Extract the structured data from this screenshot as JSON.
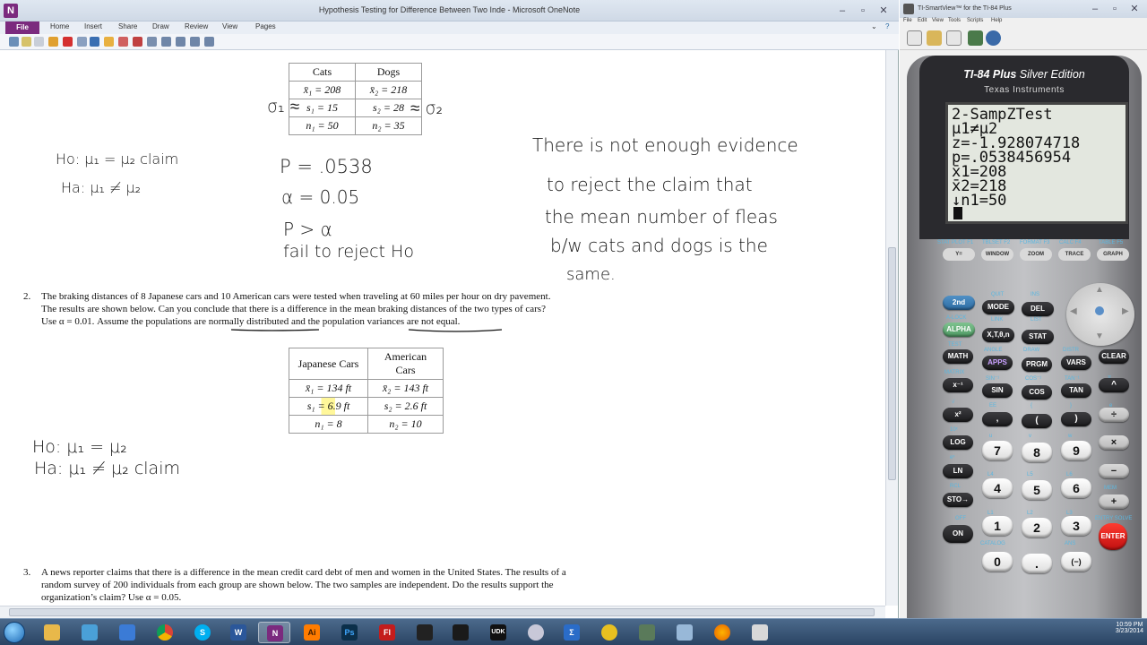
{
  "onenote": {
    "title": "Hypothesis Testing for Difference Between Two Inde  -  Microsoft OneNote",
    "app_letter": "N",
    "tabs": [
      "File",
      "Home",
      "Insert",
      "Share",
      "Draw",
      "Review",
      "View",
      "Pages"
    ],
    "table1": {
      "headers": [
        "Cats",
        "Dogs"
      ],
      "rows": [
        [
          "x̄₁ = 208",
          "x̄₂ = 218"
        ],
        [
          "s₁ = 15",
          "s₂ = 28"
        ],
        [
          "n₁ = 50",
          "n₂ = 35"
        ]
      ]
    },
    "hand1": {
      "sigma1": "σ₁ ≈",
      "sigma2": "≈ σ₂",
      "h0": "Ho:  μ₁ = μ₂   claim",
      "ha": "Ha: μ₁ ≠ μ₂",
      "p": "P = .0538",
      "alpha": "α = 0.05",
      "compare": "P > α",
      "fail": "fail to reject Ho",
      "concl1": "There is not enough evidence",
      "concl2": "to reject the claim that",
      "concl3": "the mean number of fleas",
      "concl4": "b/w cats and dogs is the",
      "concl5": "same."
    },
    "problem2": {
      "num": "2.",
      "lines": [
        "The braking distances of 8 Japanese cars and 10 American  cars were tested when traveling  at 60 miles  per hour on dry pavement.",
        "The results are shown below. Can you conclude that there is a difference in the mean braking distances of the two types of cars?",
        "Use α = 0.01. Assume the populations are normally  distributed and the population variances are not equal."
      ]
    },
    "table2": {
      "headers": [
        "Japanese Cars",
        "American Cars"
      ],
      "rows": [
        [
          "x̄₁ = 134 ft",
          "x̄₂ = 143 ft"
        ],
        [
          "s₁ = 6.9 ft",
          "s₂ = 2.6 ft"
        ],
        [
          "n₁ = 8",
          "n₂ = 10"
        ]
      ]
    },
    "hand2": {
      "h0": "Ho:  μ₁ = μ₂",
      "ha": "Ha:  μ₁ ≠ μ₂   claim"
    },
    "problem3": {
      "num": "3.",
      "lines": [
        "A news reporter claims that there is a difference in the mean credit card debt of men and women in the United States. The results of a",
        "random survey of 200 individuals  from each group are shown below. The two samples are independent. Do the results support the",
        "organization’s claim?  Use α = 0.05."
      ]
    }
  },
  "smartview": {
    "title": "TI-SmartView™ for the TI-84 Plus",
    "menu": [
      "File",
      "Edit",
      "View",
      "Tools",
      "Scripts",
      "Help"
    ],
    "brand_bold": "TI-84 Plus",
    "brand_rest": " Silver Edition",
    "maker": "Texas Instruments",
    "screen": [
      "2-SampZTest",
      " μ1≠μ2",
      " z=-1.928074718",
      " p=.0538456954",
      " x̄1=208",
      " x̄2=218",
      "↓n1=50"
    ],
    "fkey_labels": [
      "STAT PLOT  F1",
      "TBLSET  F2",
      "FORMAT  F3",
      "CALC  F4",
      "TABLE  F5"
    ],
    "fkeys": [
      "Y=",
      "WINDOW",
      "ZOOM",
      "TRACE",
      "GRAPH"
    ],
    "keys": {
      "second": "2nd",
      "mode": "MODE",
      "del": "DEL",
      "alpha": "ALPHA",
      "xt": "X,T,θ,n",
      "stat": "STAT",
      "math": "MATH",
      "apps": "APPS",
      "prgm": "PRGM",
      "vars": "VARS",
      "clear": "CLEAR",
      "inverse": "x⁻¹",
      "sin": "SIN",
      "cos": "COS",
      "tan": "TAN",
      "caret": "^",
      "square": "x²",
      "comma": ",",
      "lparen": "(",
      "rparen": ")",
      "divide": "÷",
      "log": "LOG",
      "k7": "7",
      "k8": "8",
      "k9": "9",
      "times": "×",
      "ln": "LN",
      "k4": "4",
      "k5": "5",
      "k6": "6",
      "minus": "−",
      "sto": "STO→",
      "k1": "1",
      "k2": "2",
      "k3": "3",
      "plus": "+",
      "on": "ON",
      "k0": "0",
      "dot": ".",
      "neg": "(−)",
      "enter": "ENTER"
    },
    "key_labels": {
      "quit": "QUIT",
      "ins": "INS",
      "alock": "A-LOCK",
      "link": "LINK",
      "list": "LIST",
      "test": "TEST",
      "angle": "ANGLE",
      "draw": "DRAW",
      "distr": "DISTR",
      "matrix": "MATRIX",
      "sinv": "SIN⁻¹",
      "cosv": "COS⁻¹",
      "tanv": "TAN⁻¹",
      "pi": "π",
      "root": "√",
      "ee": "EE",
      "lbrace": "{",
      "rbrace": "}",
      "e": "e",
      "tenx": "10ˣ",
      "u": "u",
      "v": "v",
      "w": "w",
      "ex": "eˣ",
      "l4": "L4",
      "l5": "L5",
      "l6": "L6",
      "rcl": "RCL",
      "l1": "L1",
      "l2": "L2",
      "l3": "L3",
      "mem": "MEM",
      "off": "OFF",
      "catalog": "CATALOG",
      "ans": "ANS",
      "entry": "ENTRY SOLVE"
    }
  },
  "taskbar": {
    "apps": [
      "folder",
      "network",
      "chrome",
      "skype",
      "word",
      "onenote",
      "illustrator",
      "photoshop",
      "flash",
      "terminal",
      "udk",
      "tool",
      "math",
      "music",
      "archive",
      "firefox",
      "editor"
    ],
    "time": "10:59 PM",
    "date": "3/23/2014"
  },
  "colors": {
    "onenote_purple": "#7b2a7e",
    "calc_blue": "#3a7db8",
    "enter_red": "#e11a1a"
  }
}
